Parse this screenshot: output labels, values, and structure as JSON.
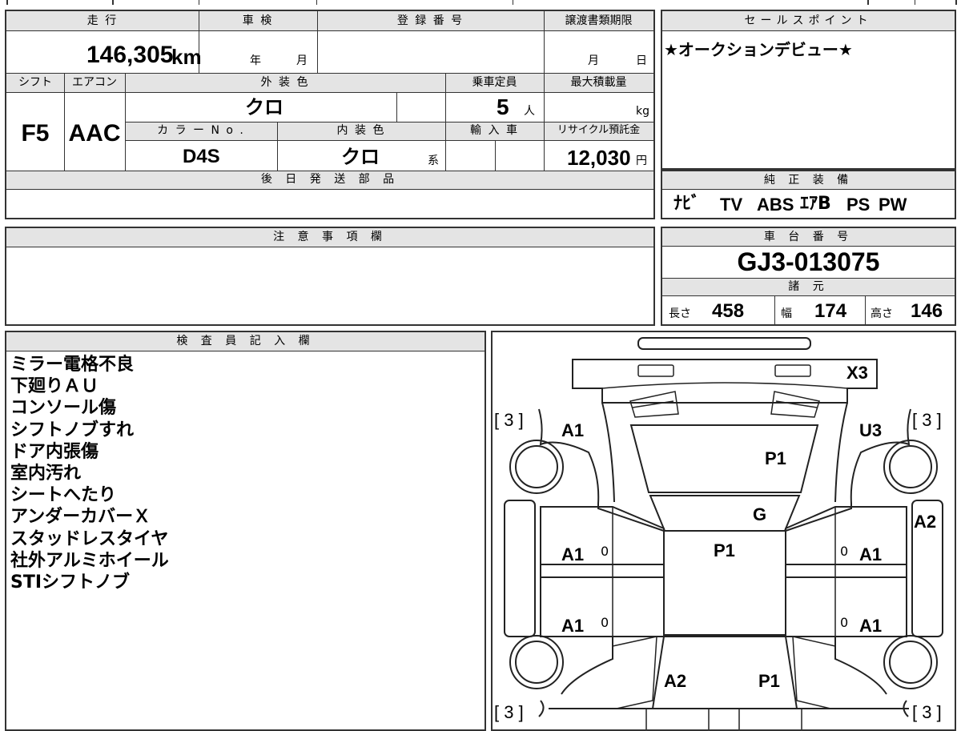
{
  "vehicle": {
    "mileage_label": "走 行",
    "mileage": "146,305",
    "mileage_unit": "km",
    "shaken_label": "車 検",
    "shaken_year_unit": "年",
    "shaken_month_unit": "月",
    "reg_label": "登 録 番 号",
    "doc_label": "譲渡書類期限",
    "doc_month_unit": "月",
    "doc_day_unit": "日",
    "shift_label": "シフト",
    "shift": "F5",
    "ac_label": "エアコン",
    "ac": "AAC",
    "exterior_label": "外 装 色",
    "exterior": "クロ",
    "capacity_label": "乗車定員",
    "capacity": "5",
    "capacity_unit": "人",
    "load_label": "最大積載量",
    "load_unit": "kg",
    "color_no_label": "カ ラ ー N o .",
    "color_no": "D4S",
    "interior_label": "内 装 色",
    "interior": "クロ",
    "interior_suffix": "系",
    "import_label": "輸 入 車",
    "recycle_label": "リサイクル預託金",
    "recycle": "12,030",
    "recycle_unit": "円",
    "parts_label": "後 日 発 送 部 品"
  },
  "sales": {
    "label": "セールスポイント",
    "text": "★オークションデビュー★"
  },
  "equipment": {
    "label": "純 正 装 備",
    "items": [
      "ﾅﾋﾞ",
      "TV",
      "ABS",
      "ｴｱB",
      "PS",
      "PW"
    ]
  },
  "notes": {
    "label": "注 意 事 項 欄"
  },
  "chassis": {
    "label": "車 台 番 号",
    "number": "GJ3-013075"
  },
  "specs": {
    "label": "諸 元",
    "length_label": "長さ",
    "length": "458",
    "width_label": "幅",
    "width": "174",
    "height_label": "高さ",
    "height": "146"
  },
  "inspector": {
    "label": "検 査 員 記 入 欄",
    "remarks": [
      "ミラー電格不良",
      "下廻りＡＵ",
      "コンソール傷",
      "シフトノブすれ",
      "ドア内張傷",
      "室内汚れ",
      "シートへたり",
      "アンダーカバーＸ",
      "スタッドレスタイヤ",
      "社外アルミホイール",
      "STIシフトノブ"
    ]
  },
  "diagram": {
    "tire_fl": "[ 3 ]",
    "tire_fr": "[ 3 ]",
    "tire_rl": "[ 3 ]",
    "tire_rr": "[ 3 ]",
    "front_bumper": "X3",
    "front_left_fender": "A1",
    "front_right_fender": "U3",
    "hood": "P1",
    "windshield": "G",
    "roof": "P1",
    "right_side_mirror": "A2",
    "left_front_door": "A1",
    "right_front_door": "A1",
    "left_rear_door": "A1",
    "right_rear_door": "A1",
    "door_mark_lf": "0",
    "door_mark_rf": "0",
    "door_mark_lr": "0",
    "door_mark_rr": "0",
    "trunk_left": "A2",
    "trunk_right": "P1"
  }
}
